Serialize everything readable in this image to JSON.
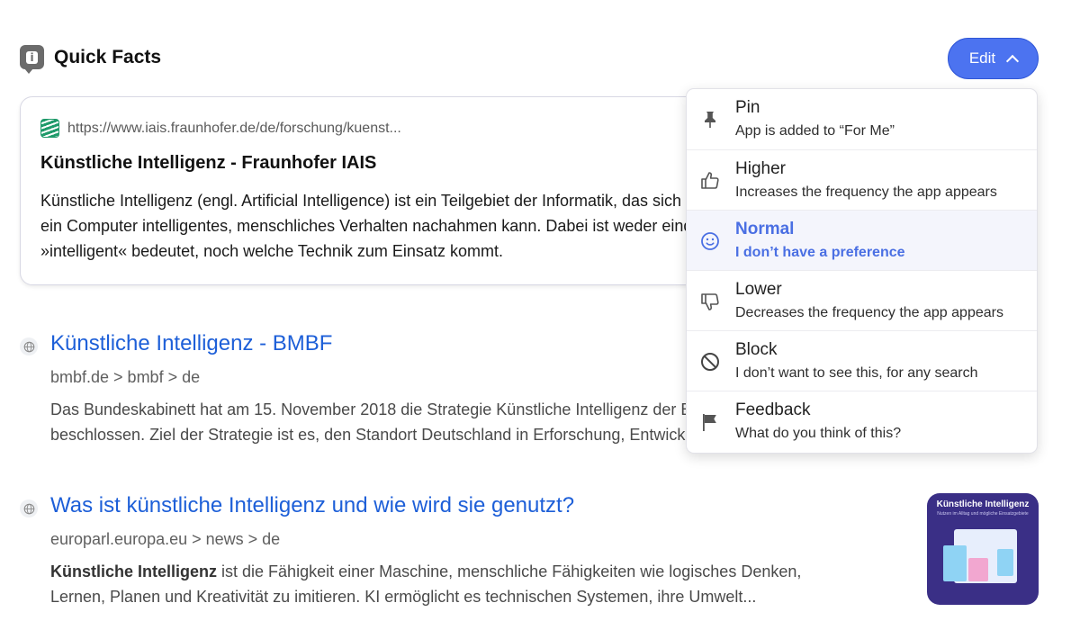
{
  "quick_facts": {
    "title": "Quick Facts",
    "url": "https://www.iais.fraunhofer.de/de/forschung/kuenst...",
    "heading": "Künstliche Intelligenz - Fraunhofer IAIS",
    "body_lines": [
      "Künstliche Intelligenz (engl. Artificial Intelligence) ist ein Teilgebiet der Informatik, das sich damit befasst, wie",
      "ein Computer intelligentes, menschliches Verhalten nachahmen kann. Dabei ist weder eindeutig definiert, was",
      "»intelligent« bedeutet, noch welche Technik zum Einsatz kommt."
    ]
  },
  "edit_button": {
    "label": "Edit",
    "accent": "#4c73f0"
  },
  "dropdown": {
    "items": [
      {
        "label": "Pin",
        "desc": "App is added to “For Me”",
        "icon": "pin-icon"
      },
      {
        "label": "Higher",
        "desc": "Increases the frequency the app appears",
        "icon": "thumbs-up-icon"
      },
      {
        "label": "Normal",
        "desc": "I don’t have a preference",
        "icon": "smiley-icon",
        "selected": true
      },
      {
        "label": "Lower",
        "desc": "Decreases the frequency the app appears",
        "icon": "thumbs-down-icon"
      },
      {
        "label": "Block",
        "desc": "I don’t want to see this, for any search",
        "icon": "block-icon"
      },
      {
        "label": "Feedback",
        "desc": "What do you think of this?",
        "icon": "flag-icon"
      }
    ],
    "selected_color": "#4a6fe3"
  },
  "results": [
    {
      "title": "Künstliche Intelligenz - BMBF",
      "breadcrumb": "bmbf.de > bmbf > de",
      "snippet_lines": [
        "Das Bundeskabinett hat am 15. November 2018 die Strategie Künstliche Intelligenz der Bundesregierung",
        "beschlossen. Ziel der Strategie ist es, den Standort Deutschland in Erforschung, Entwicklung und Anwendung"
      ]
    },
    {
      "title": "Was ist künstliche Intelligenz und wie wird sie genutzt?",
      "breadcrumb": "europarl.europa.eu > news > de",
      "snippet_bold": "Künstliche Intelligenz",
      "snippet_rest": " ist die Fähigkeit einer Maschine, menschliche Fähigkeiten wie logisches Denken,",
      "snippet_line2": "Lernen, Planen und Kreativität zu imitieren. KI ermöglicht es technischen Systemen, ihre Umwelt...",
      "thumbnail": {
        "title": "Künstliche Intelligenz",
        "subtitle": "Nutzen im Alltag und mögliche Einsatzgebiete"
      }
    }
  ]
}
